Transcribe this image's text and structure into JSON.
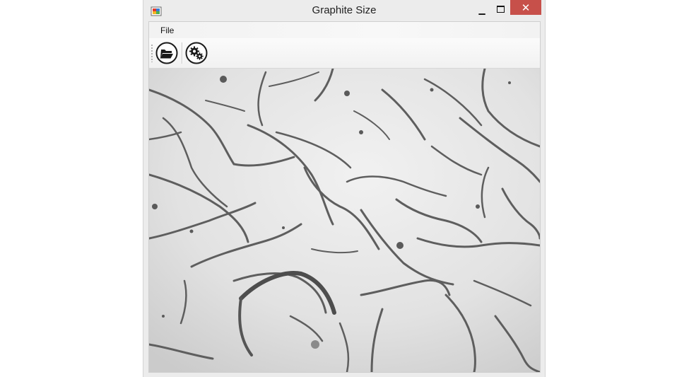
{
  "window": {
    "title": "Graphite Size",
    "close_glyph": "✕",
    "minimize_glyph": "▁"
  },
  "menu": {
    "items": [
      {
        "label": "File"
      }
    ]
  },
  "toolbar": {
    "buttons": [
      {
        "icon": "folder-open-icon"
      },
      {
        "icon": "gears-icon"
      }
    ]
  },
  "colors": {
    "close_button": "#c7504a",
    "window_frame": "#ececec",
    "image_background": "#e0e0e0",
    "graphite_flake": "#5e5e5e"
  }
}
